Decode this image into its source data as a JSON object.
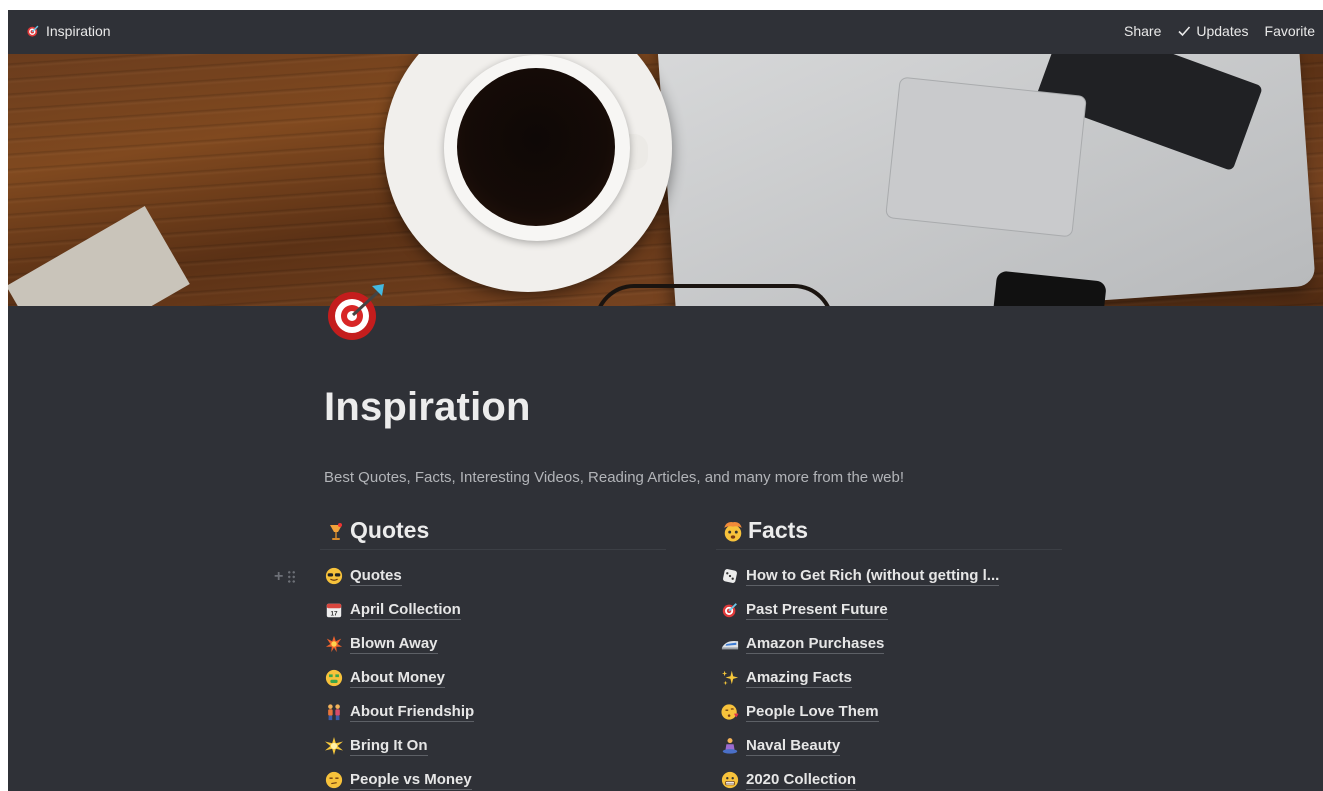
{
  "topbar": {
    "breadcrumb": "Inspiration",
    "share": "Share",
    "updates": "Updates",
    "favorite": "Favorite"
  },
  "page": {
    "title": "Inspiration",
    "description": "Best Quotes, Facts, Interesting Videos, Reading Articles, and many more from the web!"
  },
  "columns": {
    "quotes": {
      "heading": "Quotes",
      "items": [
        {
          "label": "Quotes"
        },
        {
          "label": "April Collection"
        },
        {
          "label": "Blown Away"
        },
        {
          "label": "About Money"
        },
        {
          "label": "About Friendship"
        },
        {
          "label": "Bring It On"
        },
        {
          "label": "People vs Money"
        }
      ]
    },
    "facts": {
      "heading": "Facts",
      "items": [
        {
          "label": "How to Get Rich (without getting l..."
        },
        {
          "label": "Past Present Future"
        },
        {
          "label": "Amazon Purchases"
        },
        {
          "label": "Amazing Facts"
        },
        {
          "label": "People Love Them"
        },
        {
          "label": "Naval Beauty"
        },
        {
          "label": "2020 Collection"
        }
      ]
    }
  }
}
